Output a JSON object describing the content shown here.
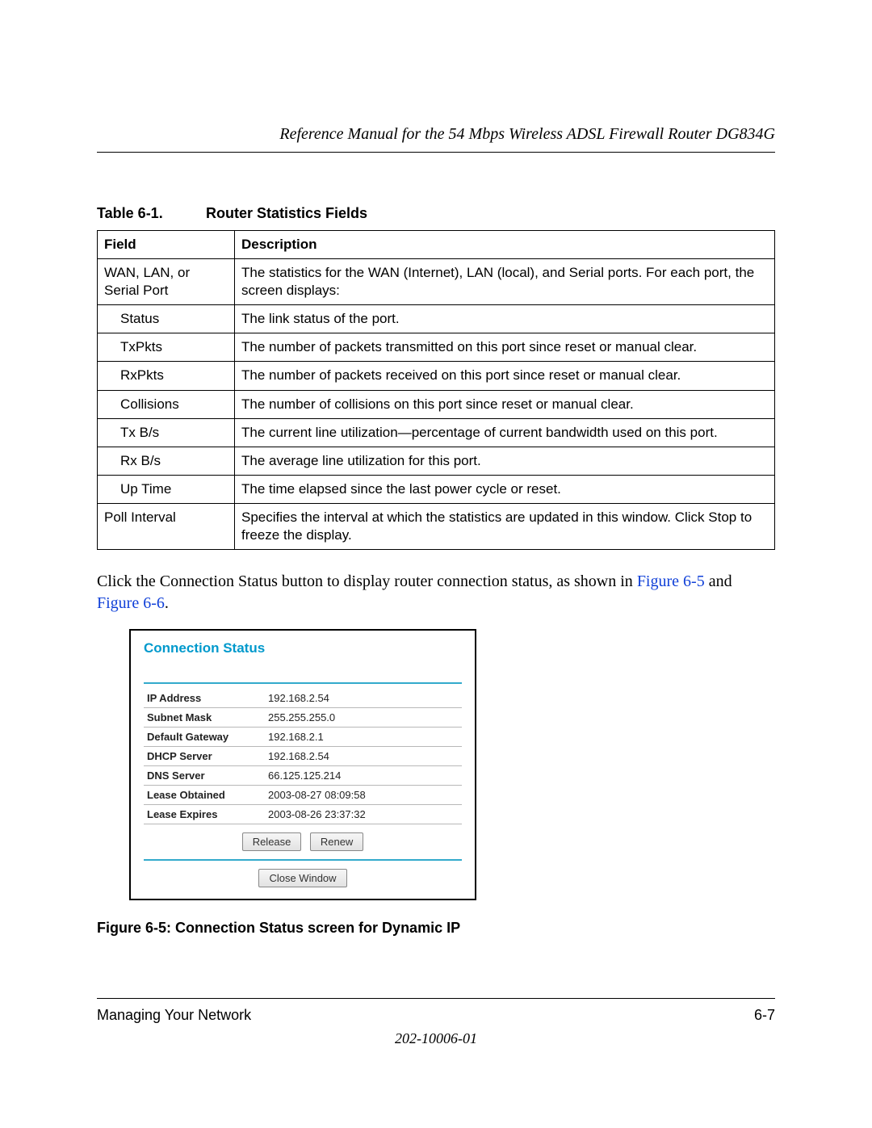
{
  "header": {
    "running_head": "Reference Manual for the 54 Mbps Wireless ADSL Firewall Router DG834G"
  },
  "table_caption": {
    "label": "Table 6-1.",
    "title": "Router Statistics Fields"
  },
  "fields_table": {
    "headers": [
      "Field",
      "Description"
    ],
    "rows": [
      {
        "field": "WAN, LAN, or Serial Port",
        "indent": 0,
        "desc": "The statistics for the WAN (Internet), LAN (local), and Serial ports. For each port, the screen displays:"
      },
      {
        "field": "Status",
        "indent": 1,
        "desc": "The link status of the port."
      },
      {
        "field": "TxPkts",
        "indent": 1,
        "desc": "The number of packets transmitted on this port since reset or manual clear."
      },
      {
        "field": "RxPkts",
        "indent": 1,
        "desc": "The number of packets received on this port since reset or manual clear."
      },
      {
        "field": "Collisions",
        "indent": 1,
        "desc": "The number of collisions on this port since reset or manual clear."
      },
      {
        "field": "Tx B/s",
        "indent": 1,
        "desc": "The current line utilization—percentage of current bandwidth used on this port."
      },
      {
        "field": "Rx B/s",
        "indent": 1,
        "desc": "The average line utilization for this port."
      },
      {
        "field": "Up Time",
        "indent": 1,
        "desc": "The time elapsed since the last power cycle or reset."
      },
      {
        "field": "Poll Interval",
        "indent": 0,
        "desc": "Specifies the interval at which the statistics are updated in this window. Click Stop to freeze the display."
      }
    ]
  },
  "body": {
    "pre": "Click the Connection Status button to display router connection status, as shown in ",
    "xref1": "Figure 6-5",
    "mid": " and ",
    "xref2": "Figure 6-6",
    "post": "."
  },
  "connection_status": {
    "title": "Connection Status",
    "rows": [
      {
        "k": "IP Address",
        "v": "192.168.2.54"
      },
      {
        "k": "Subnet Mask",
        "v": "255.255.255.0"
      },
      {
        "k": "Default Gateway",
        "v": "192.168.2.1"
      },
      {
        "k": "DHCP Server",
        "v": "192.168.2.54"
      },
      {
        "k": "DNS Server",
        "v": "66.125.125.214"
      },
      {
        "k": "Lease Obtained",
        "v": "2003-08-27 08:09:58"
      },
      {
        "k": "Lease Expires",
        "v": "2003-08-26 23:37:32"
      }
    ],
    "buttons": {
      "release": "Release",
      "renew": "Renew",
      "close": "Close Window"
    }
  },
  "figure_caption": "Figure 6-5:  Connection Status screen for Dynamic IP",
  "footer": {
    "section": "Managing Your Network",
    "page": "6-7",
    "docnum": "202-10006-01"
  }
}
